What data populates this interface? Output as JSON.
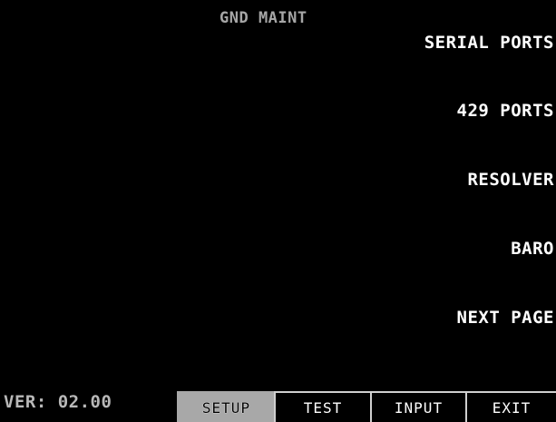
{
  "screen": {
    "title": "GND MAINT",
    "version": "VER: 02.00"
  },
  "menu": {
    "items": [
      {
        "label": "SERIAL PORTS"
      },
      {
        "label": "429 PORTS"
      },
      {
        "label": "RESOLVER"
      },
      {
        "label": "BARO"
      },
      {
        "label": "NEXT PAGE"
      }
    ]
  },
  "softkeys": {
    "setup": "SETUP",
    "test": "TEST",
    "input": "INPUT",
    "exit": "EXIT",
    "active": "SETUP"
  },
  "colors": {
    "background": "#000000",
    "menu_text": "#ffffff",
    "title_text": "#a6a6a6",
    "version_text": "#b8b8b8",
    "active_softkey_bg": "#a8a8a8"
  }
}
